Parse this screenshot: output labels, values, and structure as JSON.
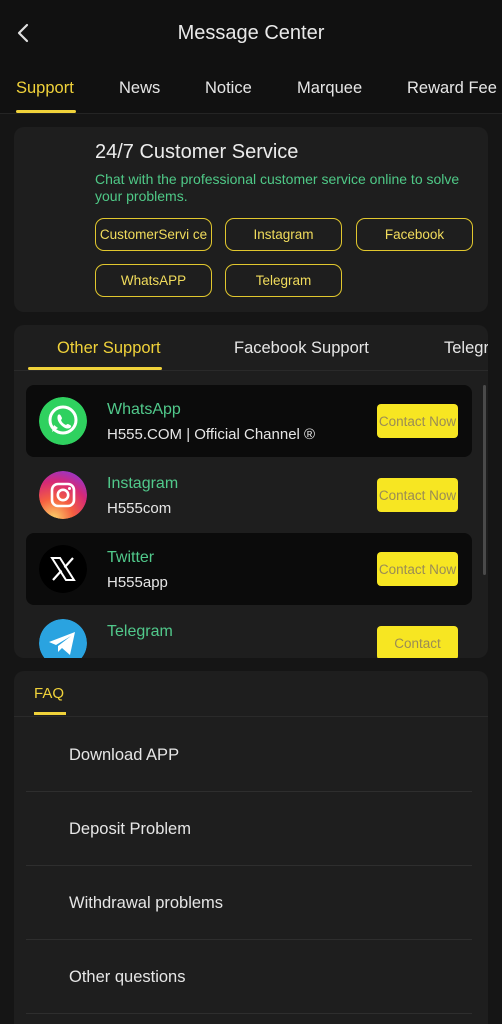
{
  "header": {
    "title": "Message Center"
  },
  "tabs": [
    {
      "label": "Support",
      "active": true
    },
    {
      "label": "News",
      "active": false
    },
    {
      "label": "Notice",
      "active": false
    },
    {
      "label": "Marquee",
      "active": false
    },
    {
      "label": "Reward Fee",
      "active": false
    }
  ],
  "customer_service": {
    "title": "24/7 Customer Service",
    "description": "Chat with the professional customer service online to solve your problems.",
    "chips": [
      "CustomerServi ce",
      "Instagram",
      "Facebook",
      "WhatsAPP",
      "Telegram"
    ]
  },
  "other_support": {
    "tabs": [
      {
        "label": "Other Support",
        "active": true
      },
      {
        "label": "Facebook Support",
        "active": false
      },
      {
        "label": "Telegr",
        "active": false
      }
    ],
    "contacts": [
      {
        "name": "WhatsApp",
        "handle": "H555.COM | Official Channel ®",
        "button": "Contact Now",
        "icon": "whatsapp-icon"
      },
      {
        "name": "Instagram",
        "handle": "H555com",
        "button": "Contact Now",
        "icon": "instagram-icon"
      },
      {
        "name": "Twitter",
        "handle": "H555app",
        "button": "Contact Now",
        "icon": "x-icon"
      },
      {
        "name": "Telegram",
        "handle": "",
        "button": "Contact",
        "icon": "telegram-icon"
      }
    ]
  },
  "faq": {
    "title": "FAQ",
    "items": [
      "Download APP",
      "Deposit Problem",
      "Withdrawal problems",
      "Other questions"
    ]
  },
  "colors": {
    "accent": "#f0d23a",
    "green_text": "#51c98b",
    "button_yellow": "#f7e622"
  }
}
